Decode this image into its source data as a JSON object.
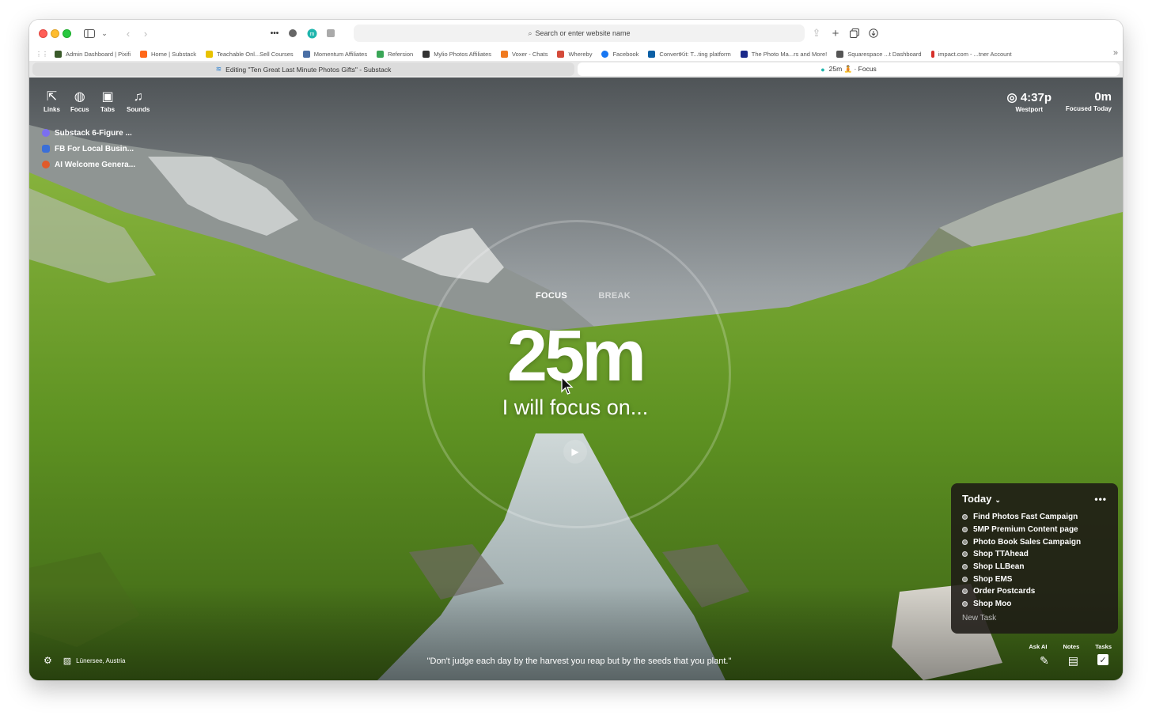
{
  "browser": {
    "address_placeholder": "Search or enter website name",
    "bookmarks": [
      {
        "label": "Admin Dashboard | Pixifi",
        "color": "#3a5a2a"
      },
      {
        "label": "Home | Substack",
        "color": "#ff6719"
      },
      {
        "label": "Teachable Onl...Sell Courses",
        "color": "#e8c200"
      },
      {
        "label": "Momentum Affiliates",
        "color": "#4a6fa5"
      },
      {
        "label": "Refersion",
        "color": "#3aa657"
      },
      {
        "label": "Mylio Photos Affiliates",
        "color": "#333333"
      },
      {
        "label": "Voxer - Chats",
        "color": "#f07a20"
      },
      {
        "label": "Whereby",
        "color": "#d44a3a"
      },
      {
        "label": "Facebook",
        "color": "#1877f2"
      },
      {
        "label": "ConvertKit: T...ting platform",
        "color": "#0b5fa5"
      },
      {
        "label": "The Photo Ma...rs and More!",
        "color": "#1b2a8a"
      },
      {
        "label": "Squarespace ...t Dashboard",
        "color": "#555555"
      },
      {
        "label": "impact.com - ...tner Account",
        "color": "#d6302a"
      }
    ],
    "tabs": [
      {
        "label": "Editing \"Ten Great Last Minute Photos Gifts\" - Substack",
        "icon": "≋"
      },
      {
        "label": "25m 🧘 · Focus",
        "icon": "●"
      }
    ]
  },
  "widgets": {
    "links": "Links",
    "focus": "Focus",
    "tabs": "Tabs",
    "sounds": "Sounds"
  },
  "link_list": [
    {
      "label": "Substack 6-Figure ...",
      "color": "#7b6ff0"
    },
    {
      "label": "FB For Local Busin...",
      "color": "#3b6fd8"
    },
    {
      "label": "AI Welcome Genera...",
      "color": "#e05a2a"
    }
  ],
  "clock": {
    "time": "4:37p",
    "location": "Westport"
  },
  "focused": {
    "value": "0m",
    "label": "Focused Today"
  },
  "timer": {
    "mode_focus": "FOCUS",
    "mode_break": "BREAK",
    "value": "25m",
    "prompt": "I will focus on..."
  },
  "tasks": {
    "title": "Today",
    "items": [
      "Find Photos Fast Campaign",
      "5MP Premium Content page",
      "Photo Book Sales Campaign",
      "Shop TTAhead",
      "Shop LLBean",
      "Shop EMS",
      "Order Postcards",
      "Shop Moo"
    ],
    "new_task": "New Task"
  },
  "footer": {
    "photo_location": "Lünersee, Austria",
    "quote": "\"Don't judge each day by the harvest you reap but by the seeds that you plant.\"",
    "ask_ai": "Ask AI",
    "notes": "Notes",
    "tasks": "Tasks"
  }
}
